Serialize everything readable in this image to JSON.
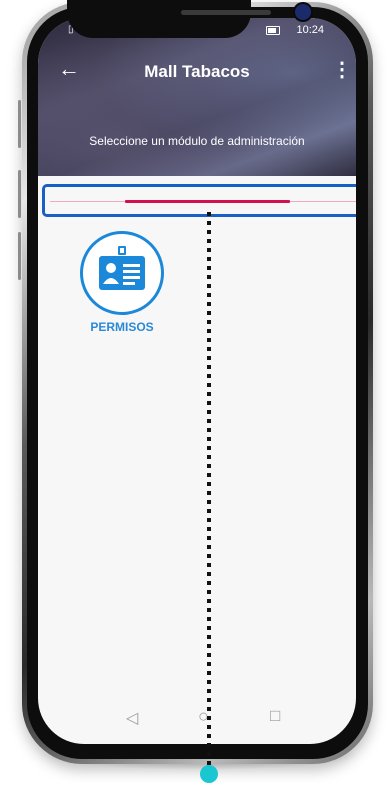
{
  "status_bar": {
    "left_icons": "▯ ≋ ⚠",
    "time": "10:24"
  },
  "header": {
    "back_icon": "arrow-left-icon",
    "back_glyph": "←",
    "title": "Mall Tabacos",
    "menu_glyph": "⋮",
    "subtitle": "Seleccione un módulo de administración"
  },
  "loading": {
    "progress": 0.54
  },
  "modules": [
    {
      "label": "PERMISOS",
      "icon": "id-card-icon"
    }
  ],
  "nav_bar": {
    "back_glyph": "◁",
    "home_glyph": "○",
    "recents_glyph": "□"
  },
  "colors": {
    "accent": "#1b88d9",
    "progress": "#d1124f",
    "highlight_border": "#1a5fc4",
    "marker": "#19c6d1"
  }
}
